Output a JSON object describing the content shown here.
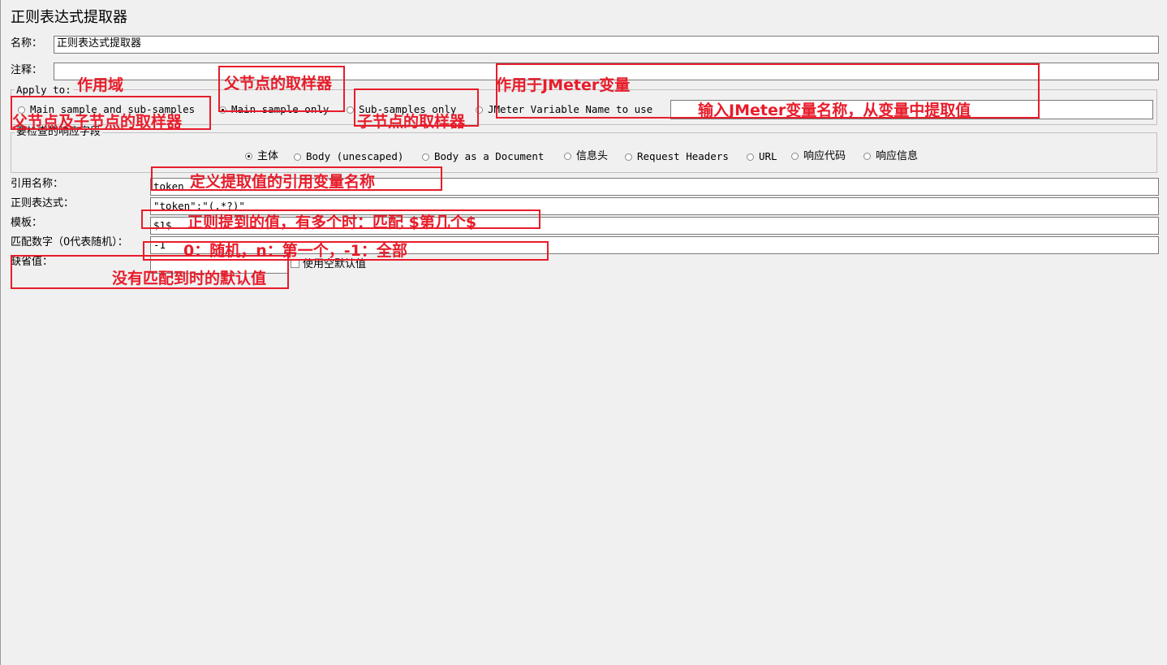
{
  "panel_title": "正则表达式提取器",
  "name_label": "名称：",
  "name_value": "正则表达式提取器",
  "comment_label": "注释：",
  "comment_value": "",
  "apply_to": {
    "legend": "Apply to:",
    "options": [
      {
        "label": "Main sample and sub-samples",
        "checked": false
      },
      {
        "label": "Main sample only",
        "checked": true
      },
      {
        "label": "Sub-samples only",
        "checked": false
      },
      {
        "label": "JMeter Variable Name to use",
        "checked": false
      }
    ],
    "variable_value": ""
  },
  "field_check": {
    "legend": "要检查的响应字段",
    "options": [
      {
        "label": "主体",
        "checked": true
      },
      {
        "label": "Body (unescaped)",
        "checked": false
      },
      {
        "label": "Body as a Document",
        "checked": false
      },
      {
        "label": "信息头",
        "checked": false
      },
      {
        "label": "Request Headers",
        "checked": false
      },
      {
        "label": "URL",
        "checked": false
      },
      {
        "label": "响应代码",
        "checked": false
      },
      {
        "label": "响应信息",
        "checked": false
      }
    ]
  },
  "form": {
    "ref_name": {
      "label": "引用名称：",
      "value": "token"
    },
    "regex": {
      "label": "正则表达式：",
      "value": "\"token\":\"(.*?)\""
    },
    "template": {
      "label": "模板：",
      "value": "$1$"
    },
    "match_no": {
      "label": "匹配数字（0代表随机）：",
      "value": "-1"
    },
    "default": {
      "label": "缺省值：",
      "checkbox_label": "使用空默认值"
    }
  },
  "annotations": {
    "scope": "作用域",
    "parent_sampler": "父节点的取样器",
    "parent_and_child": "父节点及子节点的取样器",
    "child_sampler": "子节点的取样器",
    "jmeter_var": "作用于JMeter变量",
    "jmeter_var_input": "输入JMeter变量名称，从变量中提取值",
    "ref_name": "定义提取值的引用变量名称",
    "template": "正则提到的值，有多个时：匹配 $第几个$",
    "match_no": "0：随机，n：第一个，-1：全部",
    "default": "没有匹配到时的默认值"
  },
  "colors": {
    "annotation": "#e81c2a",
    "background": "#f0f0f0"
  }
}
